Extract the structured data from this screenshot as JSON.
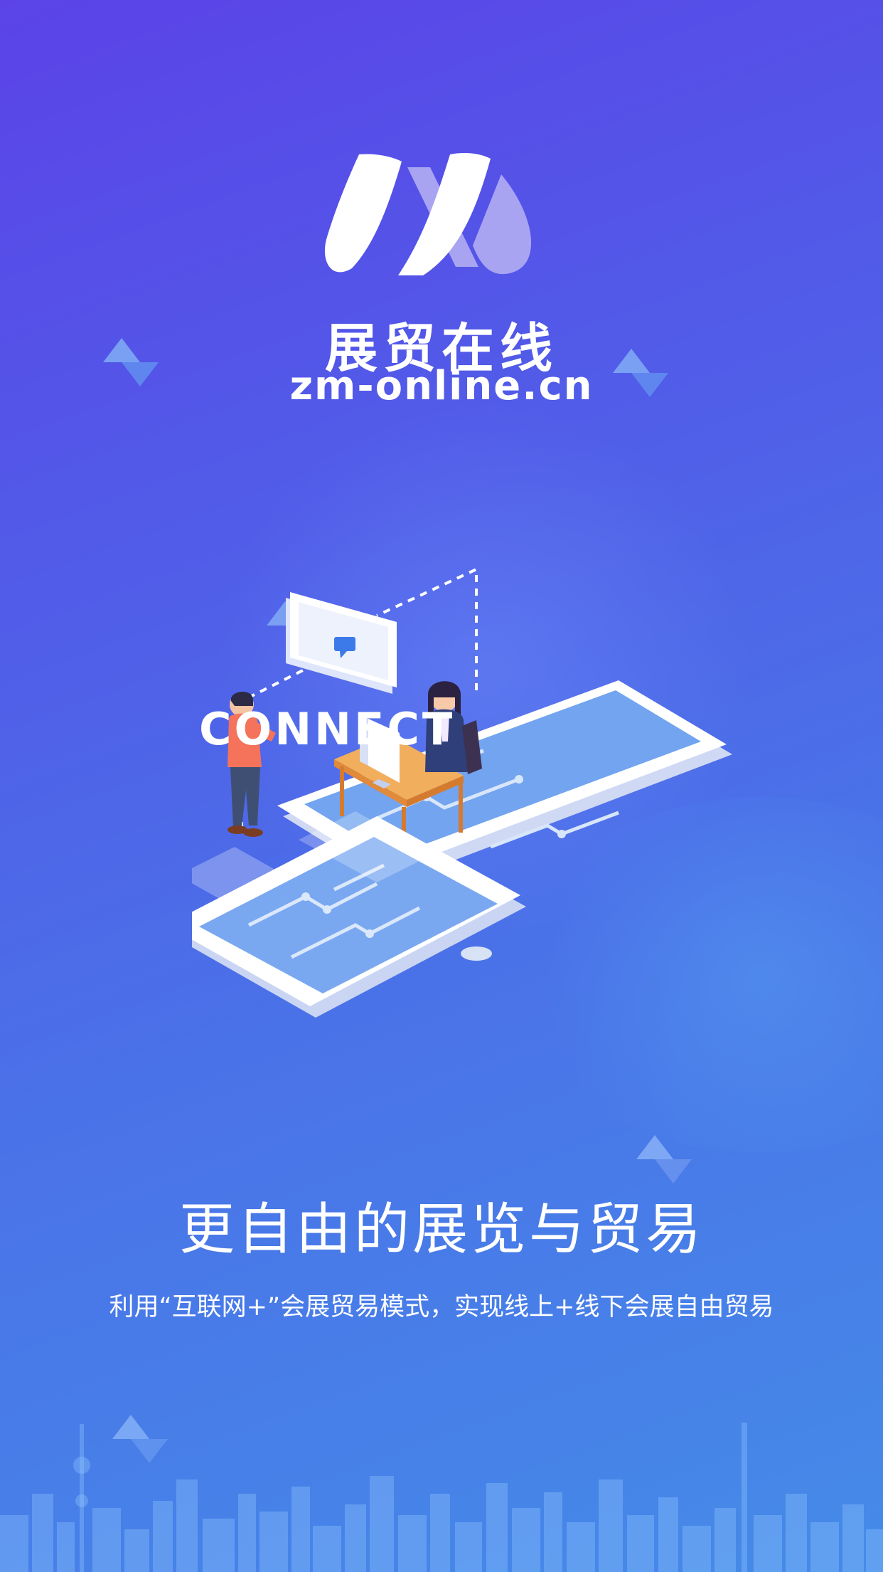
{
  "brand": {
    "name": "展贸在线",
    "url": "zm-online.cn"
  },
  "illustration": {
    "connect_text": "CONNECT"
  },
  "intro": {
    "headline": "更自由的展览与贸易",
    "description": "利用“互联网+”会展贸易模式，实现线上+线下会展自由贸易"
  },
  "colors": {
    "background_top": "#5b43e8",
    "background_bottom": "#458be8",
    "logo_light": "#ffffff",
    "logo_shade": "#a8a4f2",
    "text": "#ffffff"
  },
  "icons": [
    "brand-logo-icon",
    "chat-bubble-icon",
    "triangle-decoration-icon",
    "city-skyline-icon"
  ]
}
